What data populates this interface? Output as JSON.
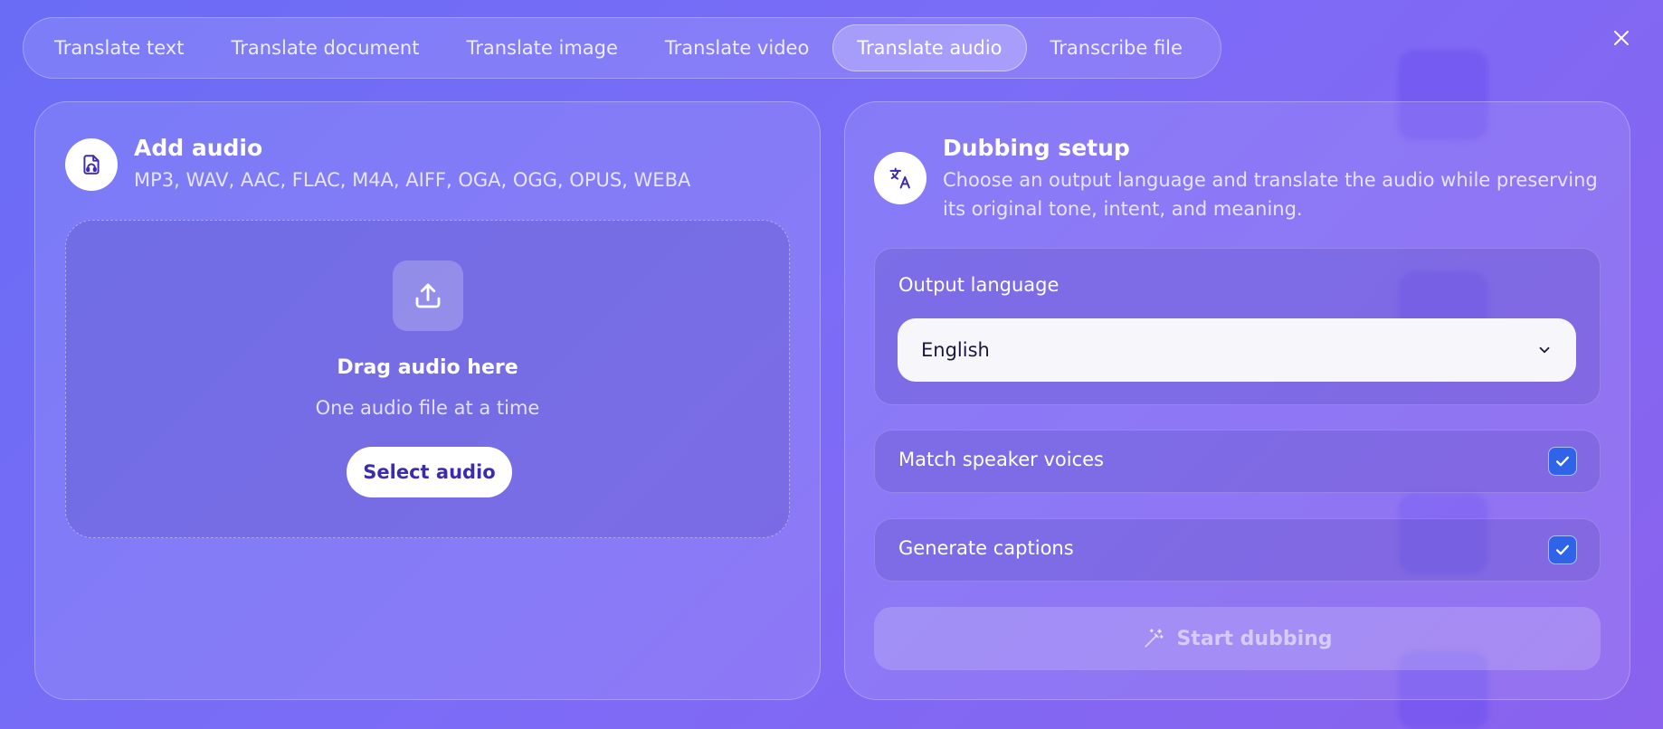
{
  "tabs": [
    {
      "label": "Translate text"
    },
    {
      "label": "Translate document"
    },
    {
      "label": "Translate image"
    },
    {
      "label": "Translate video"
    },
    {
      "label": "Translate audio",
      "active": true
    },
    {
      "label": "Transcribe file"
    }
  ],
  "left_panel": {
    "title": "Add audio",
    "formats": "MP3, WAV, AAC, FLAC, M4A, AIFF, OGA, OGG, OPUS, WEBA",
    "icon": "audio-file-icon",
    "dropzone": {
      "icon": "upload-icon",
      "title": "Drag audio here",
      "subtitle": "One audio file at a time",
      "button_label": "Select audio"
    }
  },
  "right_panel": {
    "title": "Dubbing setup",
    "description": "Choose an output language and translate the audio while preserving its original tone, intent, and meaning.",
    "icon": "translate-icon",
    "output_language": {
      "label": "Output language",
      "value": "English"
    },
    "options": [
      {
        "label": "Match speaker voices",
        "checked": true
      },
      {
        "label": "Generate captions",
        "checked": true
      }
    ],
    "start_button": {
      "label": "Start dubbing",
      "icon": "magic-wand-icon",
      "disabled": true
    }
  },
  "colors": {
    "accent": "#2f63e8",
    "button_text": "#3b2bb0",
    "background_start": "#6a6cf6",
    "background_end": "#8a62ee"
  }
}
